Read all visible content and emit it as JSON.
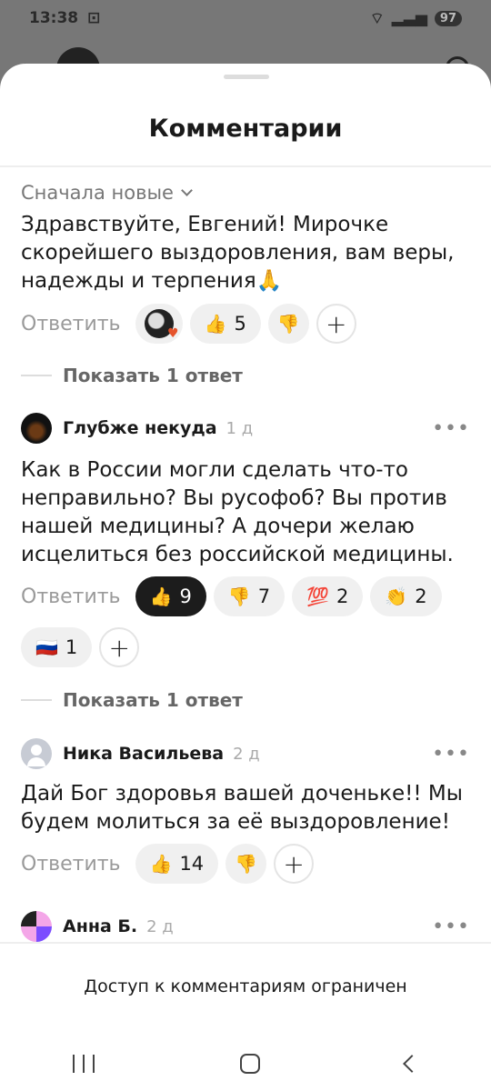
{
  "status": {
    "time": "13:38",
    "battery": "97"
  },
  "sheet": {
    "title": "Комментарии",
    "sort_label": "Сначала новые"
  },
  "comments": [
    {
      "text": "Здравствуйте, Евгений! Мирочке скорейшего выздоровления, вам веры, надежды и терпения🙏",
      "reply_label": "Ответить",
      "reactions": [
        {
          "emoji": "👍",
          "count": "5"
        },
        {
          "emoji": "👎",
          "count": ""
        }
      ],
      "show_replies": "Показать 1 ответ"
    },
    {
      "author": "Глубже некуда",
      "time": "1 д",
      "text": "Как в России могли сделать что-то неправильно? Вы русофоб? Вы против нашей медицины? А дочери желаю исцелиться без российской медицины.",
      "reply_label": "Ответить",
      "reactions": [
        {
          "emoji": "👍",
          "count": "9"
        },
        {
          "emoji": "👎",
          "count": "7"
        },
        {
          "emoji": "💯",
          "count": "2"
        },
        {
          "emoji": "👏",
          "count": "2"
        },
        {
          "emoji": "🇷🇺",
          "count": "1"
        }
      ],
      "show_replies": "Показать 1 ответ"
    },
    {
      "author": "Ника Васильева",
      "time": "2 д",
      "text": "Дай Бог здоровья вашей доченьке!! Мы будем молиться за её выздоровление!",
      "reply_label": "Ответить",
      "reactions": [
        {
          "emoji": "👍",
          "count": "14"
        },
        {
          "emoji": "👎",
          "count": ""
        }
      ]
    },
    {
      "author": "Анна Б.",
      "time": "2 д"
    }
  ],
  "footer": {
    "text": "Доступ к комментариям ограничен"
  },
  "icons": {
    "more": "more-dots-icon",
    "add": "add-reaction-icon",
    "chevron": "chevron-down-icon"
  }
}
